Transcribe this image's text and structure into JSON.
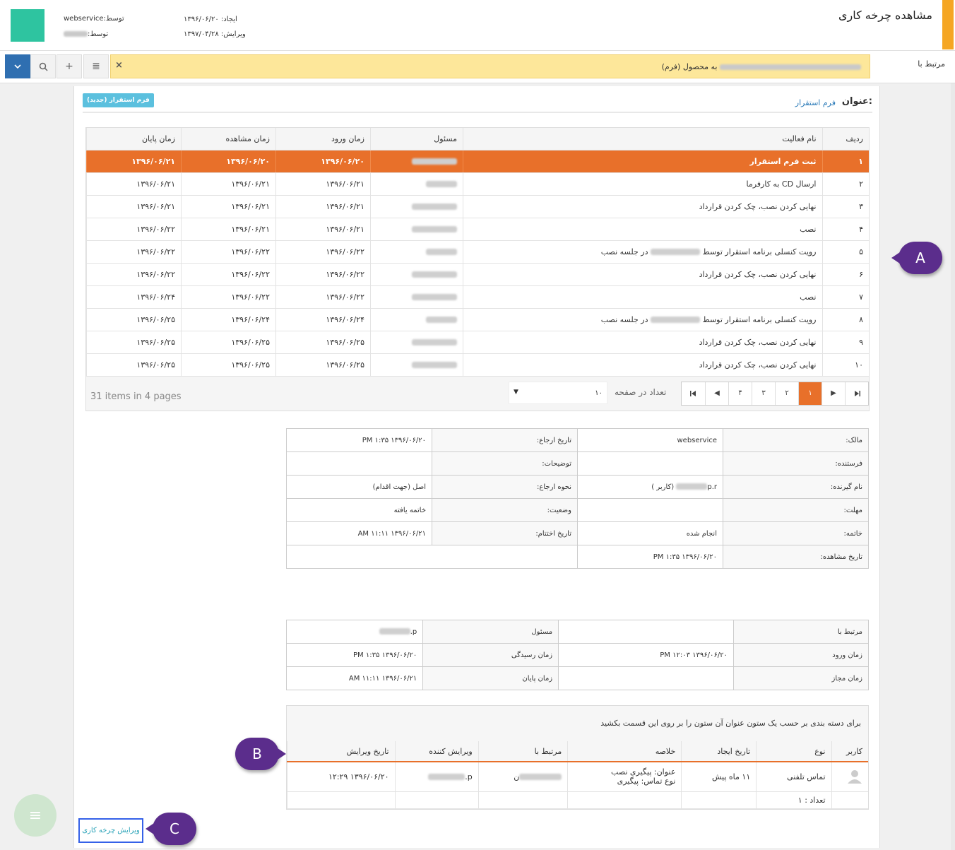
{
  "header": {
    "title": "مشاهده چرخه کاری",
    "created_label": "ایجاد:",
    "created_date": "۱۳۹۶/۰۶/۲۰",
    "edited_label": "ویرایش:",
    "edited_date": "۱۳۹۷/۰۴/۲۸",
    "by_label": "توسط:",
    "created_by": "webservice",
    "swatch_color": "#2ec4a0"
  },
  "related": {
    "label": "مرتبط با",
    "value_suffix": "به محصول (فرم)",
    "close": "×"
  },
  "toolbar": {
    "list": "≣",
    "add": "+",
    "search": "search-icon",
    "more": "chevron-down-icon"
  },
  "form": {
    "title_label": "عنوان:",
    "title_value": "فرم استقرار",
    "new_button": "فرم استقرار (جدید)"
  },
  "grid": {
    "headers": [
      "ردیف",
      "نام فعالیت",
      "مسئول",
      "زمان ورود",
      "زمان مشاهده",
      "زمان پایان"
    ],
    "rows": [
      {
        "n": "۱",
        "name": "ثبت فرم استقرار",
        "in": "۱۳۹۶/۰۶/۲۰",
        "view": "۱۳۹۶/۰۶/۲۰",
        "end": "۱۳۹۶/۰۶/۲۱"
      },
      {
        "n": "۲",
        "name": "ارسال CD به کارفرما",
        "in": "۱۳۹۶/۰۶/۲۱",
        "view": "۱۳۹۶/۰۶/۲۱",
        "end": "۱۳۹۶/۰۶/۲۱"
      },
      {
        "n": "۳",
        "name": "نهایی کردن نصب، چک کردن قرارداد",
        "in": "۱۳۹۶/۰۶/۲۱",
        "view": "۱۳۹۶/۰۶/۲۱",
        "end": "۱۳۹۶/۰۶/۲۱"
      },
      {
        "n": "۴",
        "name": "نصب",
        "in": "۱۳۹۶/۰۶/۲۱",
        "view": "۱۳۹۶/۰۶/۲۱",
        "end": "۱۳۹۶/۰۶/۲۲"
      },
      {
        "n": "۵",
        "name": "رویت کنسلی برنامه استقرار توسط",
        "suffix": "در جلسه نصب",
        "in": "۱۳۹۶/۰۶/۲۲",
        "view": "۱۳۹۶/۰۶/۲۲",
        "end": "۱۳۹۶/۰۶/۲۲"
      },
      {
        "n": "۶",
        "name": "نهایی کردن نصب، چک کردن قرارداد",
        "in": "۱۳۹۶/۰۶/۲۲",
        "view": "۱۳۹۶/۰۶/۲۲",
        "end": "۱۳۹۶/۰۶/۲۲"
      },
      {
        "n": "۷",
        "name": "نصب",
        "in": "۱۳۹۶/۰۶/۲۲",
        "view": "۱۳۹۶/۰۶/۲۲",
        "end": "۱۳۹۶/۰۶/۲۴"
      },
      {
        "n": "۸",
        "name": "رویت کنسلی برنامه استقرار توسط",
        "suffix": "در جلسه نصب",
        "in": "۱۳۹۶/۰۶/۲۴",
        "view": "۱۳۹۶/۰۶/۲۴",
        "end": "۱۳۹۶/۰۶/۲۵"
      },
      {
        "n": "۹",
        "name": "نهایی کردن نصب، چک کردن قرارداد",
        "in": "۱۳۹۶/۰۶/۲۵",
        "view": "۱۳۹۶/۰۶/۲۵",
        "end": "۱۳۹۶/۰۶/۲۵"
      },
      {
        "n": "۱۰",
        "name": "نهایی کردن نصب، چک کردن قرارداد",
        "in": "۱۳۹۶/۰۶/۲۵",
        "view": "۱۳۹۶/۰۶/۲۵",
        "end": "۱۳۹۶/۰۶/۲۵"
      }
    ],
    "pager": {
      "info": "31 items in 4 pages",
      "pages": [
        "۱",
        "۲",
        "۳",
        "۴"
      ],
      "current": "۱",
      "size_label": "تعداد در صفحه",
      "size_value": "۱۰",
      "first": "⏮",
      "prev": "◀",
      "next": "▶",
      "last": "⏭"
    }
  },
  "details": {
    "owner_label": "مالک:",
    "owner": "webservice",
    "ref_date_label": "تاریخ ارجاع:",
    "ref_date": "۱۳۹۶/۰۶/۲۰ ۱:۳۵ PM",
    "sender_label": "فرستنده:",
    "desc_label": "توضیحات:",
    "receiver_label": "نام گیرنده:",
    "receiver": "p.r",
    "receiver_role": "(کاربر )",
    "ref_type_label": "نحوه ارجاع:",
    "ref_type": "اصل (جهت اقدام)",
    "deadline_label": "مهلت:",
    "status_label": "وضعیت:",
    "status": "خاتمه یافته",
    "end_label": "خاتمه:",
    "end": "انجام شده",
    "end_date_label": "تاریخ اختتام:",
    "end_date": "۱۳۹۶/۰۶/۲۱ ۱۱:۱۱ AM",
    "view_date_label": "تاریخ مشاهده:",
    "view_date": "۱۳۹۶/۰۶/۲۰ ۱:۳۵ PM"
  },
  "times": {
    "related_label": "مرتبط با",
    "resp_label": "مسئول",
    "resp": "p.",
    "in_label": "زمان ورود",
    "in": "۱۳۹۶/۰۶/۲۰ ۱۲:۰۳ PM",
    "arrive_label": "زمان رسیدگی",
    "arrive": "۱۳۹۶/۰۶/۲۰ ۱:۳۵ PM",
    "allowed_label": "زمان مجاز",
    "end_label": "زمان پایان",
    "end": "۱۳۹۶/۰۶/۲۱ ۱۱:۱۱ AM"
  },
  "history": {
    "hint": "برای دسته بندی بر حسب یک ستون عنوان آن ستون را بر روی این قسمت بکشید",
    "headers": [
      "کاربر",
      "نوع",
      "تاریخ ایجاد",
      "خلاصه",
      "مرتبط با",
      "ویرایش کننده",
      "تاریخ ویرایش"
    ],
    "row": {
      "type": "تماس تلفنی",
      "created": "۱۱ ماه پیش",
      "summary1": "عنوان: پیگیری نصب",
      "summary2": "نوع تماس: پیگیری",
      "related_suffix": "ن",
      "editor": "p.",
      "edited": "۱۳۹۶/۰۶/۲۰ ۱۲:۲۹"
    },
    "count": "تعداد : ۱"
  },
  "footer": {
    "edit_link": "ویرایش چرخه کاری",
    "menu": "≡"
  },
  "callouts": {
    "a": "A",
    "b": "B",
    "c": "C",
    "color": "#5b2d8c"
  }
}
